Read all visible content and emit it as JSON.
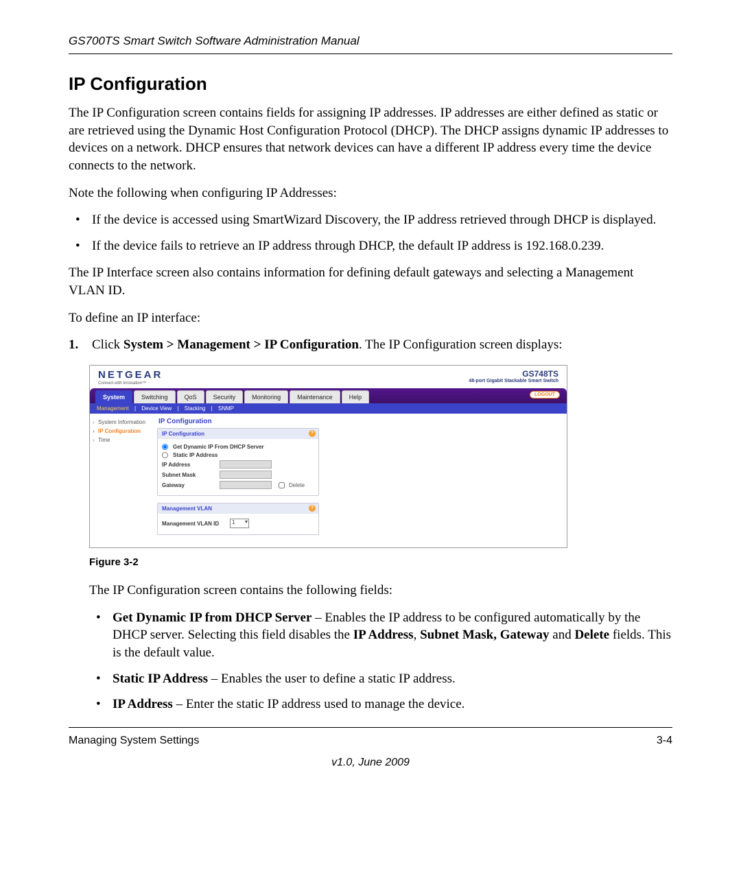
{
  "header": {
    "manual_title": "GS700TS Smart Switch Software Administration Manual"
  },
  "section": {
    "title": "IP Configuration"
  },
  "paragraphs": {
    "intro": "The IP Configuration screen contains fields for assigning IP addresses. IP addresses are either defined as static or are retrieved using the Dynamic Host Configuration Protocol (DHCP). The DHCP assigns dynamic IP addresses to devices on a network. DHCP ensures that network devices can have a different IP address every time the device connects to the network.",
    "note_lead": "Note the following when configuring IP Addresses:",
    "bullet1": "If the device is accessed using SmartWizard Discovery, the IP address retrieved through DHCP is displayed.",
    "bullet2": "If the device fails to retrieve an IP address through DHCP, the default IP address is 192.168.0.239.",
    "after_bullets": "The IP Interface screen also contains information for defining default gateways and selecting a Management VLAN ID.",
    "to_define": "To define an IP interface:",
    "step1_prefix": "Click ",
    "step1_path": "System > Management > IP Configuration",
    "step1_suffix": ". The IP Configuration screen displays:",
    "after_fig": "The IP Configuration screen contains the following fields:",
    "fld1_name": "Get Dynamic IP from DHCP Server",
    "fld1_desc_a": " – Enables the IP address to be configured automatically by the DHCP server. Selecting this field disables the ",
    "fld1_bold2": "IP Address",
    "fld1_sep": ", ",
    "fld1_bold3": "Subnet Mask, Gateway",
    "fld1_mid": " and ",
    "fld1_bold4": "Delete",
    "fld1_end": " fields. This is the default value.",
    "fld2_name": "Static IP Address",
    "fld2_desc": " – Enables the user to define a static IP address.",
    "fld3_name": "IP Address",
    "fld3_desc": " – Enter the static IP address used to manage the device."
  },
  "figure": {
    "caption": "Figure 3-2",
    "logo": "NETGEAR",
    "logo_tag": "Connect with Innovation™",
    "product_model": "GS748TS",
    "product_desc": "48-port Gigabit Stackable Smart Switch",
    "tabs": [
      "System",
      "Switching",
      "QoS",
      "Security",
      "Monitoring",
      "Maintenance",
      "Help"
    ],
    "logout": "LOGOUT",
    "subnav": [
      "Management",
      "Device View",
      "Stacking",
      "SNMP"
    ],
    "sidebar": [
      "System Information",
      "IP Configuration",
      "Time"
    ],
    "panel_title": "IP Configuration",
    "panel1_head": "IP Configuration",
    "radio_dhcp": "Get Dynamic IP From DHCP Server",
    "radio_static": "Static IP Address",
    "lbl_ip": "IP Address",
    "lbl_mask": "Subnet Mask",
    "lbl_gateway": "Gateway",
    "lbl_delete": "Delete",
    "panel2_head": "Management VLAN",
    "lbl_mvlan": "Management VLAN ID",
    "mvlan_value": "1"
  },
  "footer": {
    "left": "Managing System Settings",
    "right": "3-4",
    "version": "v1.0, June 2009"
  }
}
